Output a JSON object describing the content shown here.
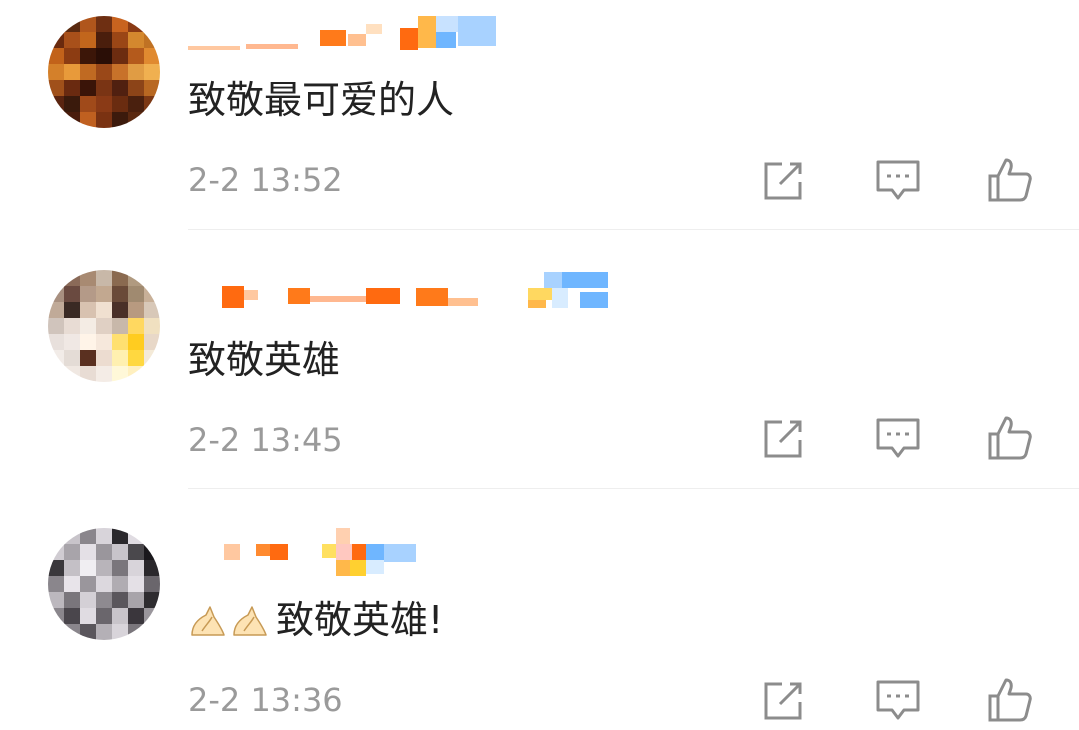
{
  "comments": [
    {
      "text": "致敬最可爱的人",
      "time": "2-2 13:52",
      "emoji": ""
    },
    {
      "text": "致敬英雄",
      "time": "2-2 13:45",
      "emoji": ""
    },
    {
      "text": "致敬英雄!",
      "time": "2-2 13:36",
      "emoji": "🙏🙏"
    }
  ],
  "icons": {
    "forward": "share-edit-icon",
    "reply": "comment-icon",
    "like": "thumbs-up-icon"
  },
  "colors": {
    "text": "#222222",
    "meta": "#9a9a9a",
    "icon": "#8c8c8c",
    "divider": "#eeeeee",
    "username_orange": "#ff7a1a",
    "username_blue": "#6fb6ff"
  }
}
